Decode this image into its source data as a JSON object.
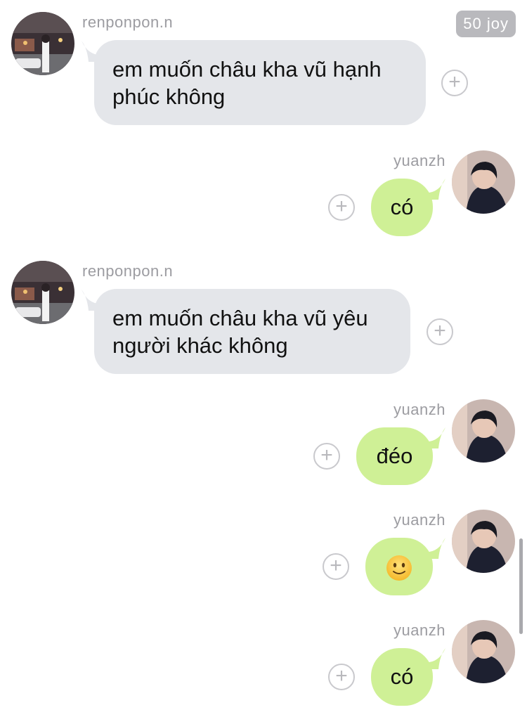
{
  "badge": {
    "label": "50 joy"
  },
  "messages": [
    {
      "sender": "renponpon.n",
      "direction": "incoming",
      "text": "em muốn châu kha vũ hạnh phúc không",
      "line1": "em muốn châu kha vũ hạnh",
      "line2": "phúc không"
    },
    {
      "sender": "yuanzh",
      "direction": "outgoing",
      "text": "có"
    },
    {
      "sender": "renponpon.n",
      "direction": "incoming",
      "text": "em muốn châu kha vũ yêu người khác không",
      "line1": "em muốn châu kha vũ yêu",
      "line2": "người khác không"
    },
    {
      "sender": "yuanzh",
      "direction": "outgoing",
      "text": "đéo"
    },
    {
      "sender": "yuanzh",
      "direction": "outgoing",
      "text": "",
      "emoji": "slightly-smiling-face-icon"
    },
    {
      "sender": "yuanzh",
      "direction": "outgoing",
      "text": "có"
    }
  ],
  "reaction_button": {
    "symbol": "+"
  },
  "colors": {
    "incoming_bubble": "#e4e6ea",
    "outgoing_bubble": "#cff096",
    "badge": "#b9b9bd",
    "username": "#9c9ca1"
  }
}
